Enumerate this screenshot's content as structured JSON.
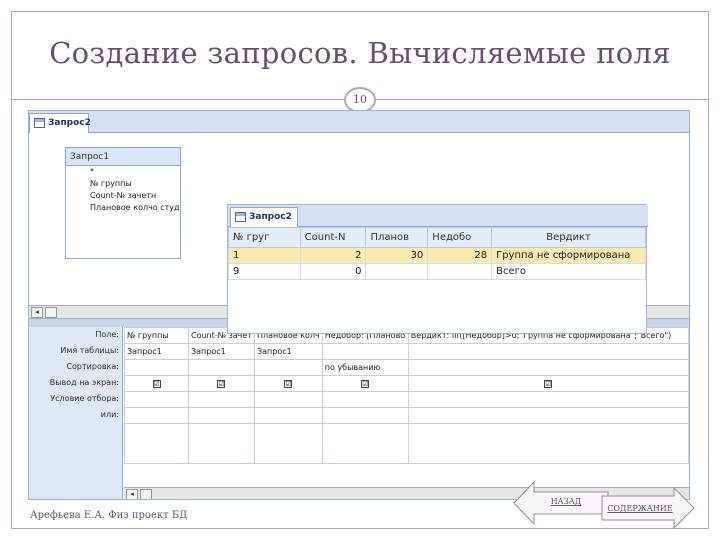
{
  "slide": {
    "title": "Создание запросов. Вычисляемые поля",
    "number": "10",
    "footer": "Арефьева Е.А. Физ проект БД",
    "nav_back": "НАЗАД",
    "nav_contents": "СОДЕРЖАНИЕ"
  },
  "design": {
    "tab_label": "Запрос2",
    "table_name": "Запрос1",
    "fields": [
      "*",
      "№ группы",
      "Count-№ зачетн",
      "Плановое колчо студ"
    ]
  },
  "result": {
    "tab_label": "Запрос2",
    "columns": [
      "№ груг",
      "Count-N",
      "Планов",
      "Недобо",
      "Вердикт"
    ],
    "rows": [
      [
        "1",
        "2",
        "30",
        "28",
        "Группа не сформирована"
      ],
      [
        "9",
        "0",
        "",
        "",
        "Всего"
      ]
    ]
  },
  "qbe": {
    "row_labels": [
      "Поле:",
      "Имя таблицы:",
      "Сортировка:",
      "Вывод на экран:",
      "Условие отбора:",
      "или:"
    ],
    "columns": [
      {
        "field": "№ группы",
        "table": "Запрос1",
        "sort": "",
        "show": "☑"
      },
      {
        "field": "Count-№ зачет",
        "table": "Запрос1",
        "sort": "",
        "show": "☑"
      },
      {
        "field": "Плановое колч",
        "table": "Запрос1",
        "sort": "",
        "show": "☑"
      },
      {
        "field": "Недобор: [Планово",
        "table": "",
        "sort": "по убыванию",
        "show": "☑"
      },
      {
        "field": "Вердикт: IIf([Недобор]>0;\"Группа не сформирована\";\"Всего\")",
        "table": "",
        "sort": "",
        "show": "☑"
      }
    ]
  },
  "colors": {
    "accent": "#6a4f70",
    "ribbon": "#d5e1f2",
    "selected_row": "#fbe9b3"
  }
}
